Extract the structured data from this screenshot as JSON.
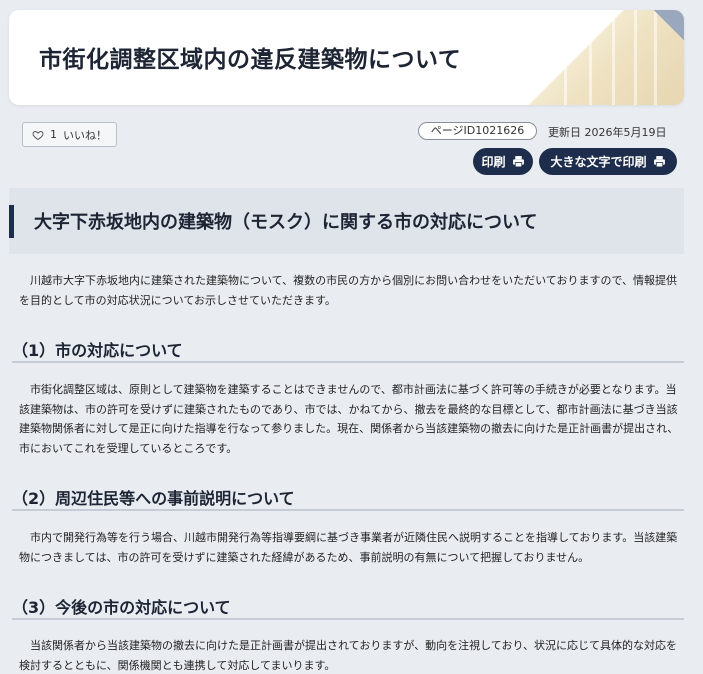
{
  "page": {
    "title": "市街化調整区域内の違反建築物について"
  },
  "meta": {
    "like_count": "1",
    "like_label": "いいね！",
    "page_id": "ページID1021626",
    "updated": "更新日 2026年5月19日",
    "print_label": "印刷",
    "big_print_label": "大きな文字で印刷"
  },
  "section": {
    "heading": "大字下赤坂地内の建築物（モスク）に関する市の対応について",
    "intro": "川越市大字下赤坂地内に建築された建築物について、複数の市民の方から個別にお問い合わせをいただいておりますので、情報提供を目的として市の対応状況についてお示しさせていただきます。"
  },
  "subsections": [
    {
      "heading": "（1）市の対応について",
      "body": "市街化調整区域は、原則として建築物を建築することはできませんので、都市計画法に基づく許可等の手続きが必要となります。当該建築物は、市の許可を受けずに建築されたものであり、市では、かねてから、撤去を最終的な目標として、都市計画法に基づき当該建築物関係者に対して是正に向けた指導を行なって参りました。現在、関係者から当該建築物の撤去に向けた是正計画書が提出され、市においてこれを受理しているところです。"
    },
    {
      "heading": "（2）周辺住民等への事前説明について",
      "body": "市内で開発行為等を行う場合、川越市開発行為等指導要綱に基づき事業者が近隣住民へ説明することを指導しております。当該建築物につきましては、市の許可を受けずに建築された経緯があるため、事前説明の有無について把握しておりません。"
    },
    {
      "heading": "（3）今後の市の対応について",
      "body": "当該関係者から当該建築物の撤去に向けた是正計画書が提出されておりますが、動向を注視しており、状況に応じて具体的な対応を検討するとともに、関係機関とも連携して対応してまいります。"
    }
  ]
}
